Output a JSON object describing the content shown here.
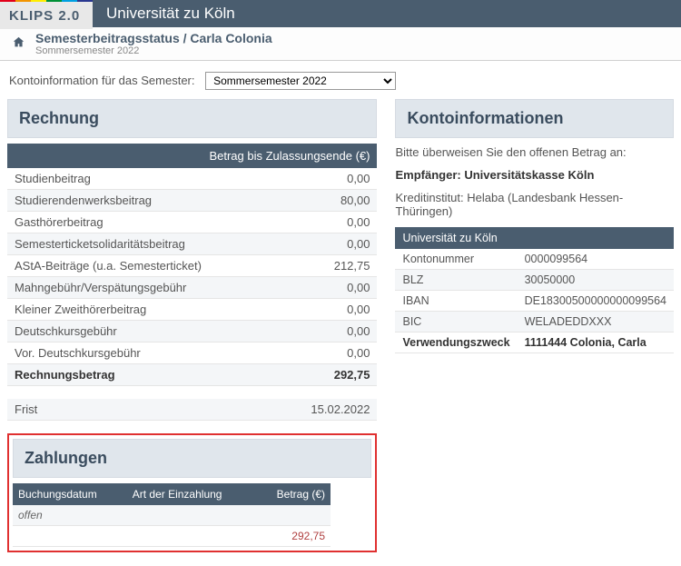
{
  "brand": {
    "logo": "KLIPS 2.0",
    "uni": "Universität zu Köln"
  },
  "breadcrumb": {
    "title": "Semesterbeitragsstatus / Carla Colonia",
    "sub": "Sommersemester 2022"
  },
  "semester": {
    "label": "Kontoinformation für das Semester:",
    "selected": "Sommersemester 2022"
  },
  "invoice": {
    "heading": "Rechnung",
    "col_header": "Betrag bis Zulassungsende (€)",
    "rows": [
      {
        "label": "Studienbeitrag",
        "value": "0,00"
      },
      {
        "label": "Studierendenwerksbeitrag",
        "value": "80,00"
      },
      {
        "label": "Gasthörerbeitrag",
        "value": "0,00"
      },
      {
        "label": "Semesterticketsolidaritätsbeitrag",
        "value": "0,00"
      },
      {
        "label": "AStA-Beiträge (u.a. Semesterticket)",
        "value": "212,75"
      },
      {
        "label": "Mahngebühr/Verspätungsgebühr",
        "value": "0,00"
      },
      {
        "label": "Kleiner Zweithörerbeitrag",
        "value": "0,00"
      },
      {
        "label": "Deutschkursgebühr",
        "value": "0,00"
      },
      {
        "label": "Vor. Deutschkursgebühr",
        "value": "0,00"
      }
    ],
    "total_label": "Rechnungsbetrag",
    "total_value": "292,75",
    "frist_label": "Frist",
    "frist_value": "15.02.2022"
  },
  "payments": {
    "heading": "Zahlungen",
    "col1": "Buchungsdatum",
    "col2": "Art der Einzahlung",
    "col3": "Betrag (€)",
    "open_label": "offen",
    "open_amount": "292,75"
  },
  "account": {
    "heading": "Kontoinformationen",
    "transfer_text": "Bitte überweisen Sie den offenen Betrag an:",
    "recipient_label": "Empfänger: Universitätskasse Köln",
    "bank_text": "Kreditinstitut: Helaba (Landesbank Hessen-Thüringen)",
    "table_header": "Universität zu Köln",
    "rows": [
      {
        "k": "Kontonummer",
        "v": "0000099564"
      },
      {
        "k": "BLZ",
        "v": "30050000"
      },
      {
        "k": "IBAN",
        "v": "DE18300500000000099564"
      },
      {
        "k": "BIC",
        "v": "WELADEDDXXX"
      },
      {
        "k": "Verwendungszweck",
        "v": "1111444 Colonia, Carla"
      }
    ]
  },
  "colors": {
    "rainbow": [
      "#e2001a",
      "#f29400",
      "#ffed00",
      "#009036",
      "#00a0e1",
      "#2a3890"
    ]
  }
}
